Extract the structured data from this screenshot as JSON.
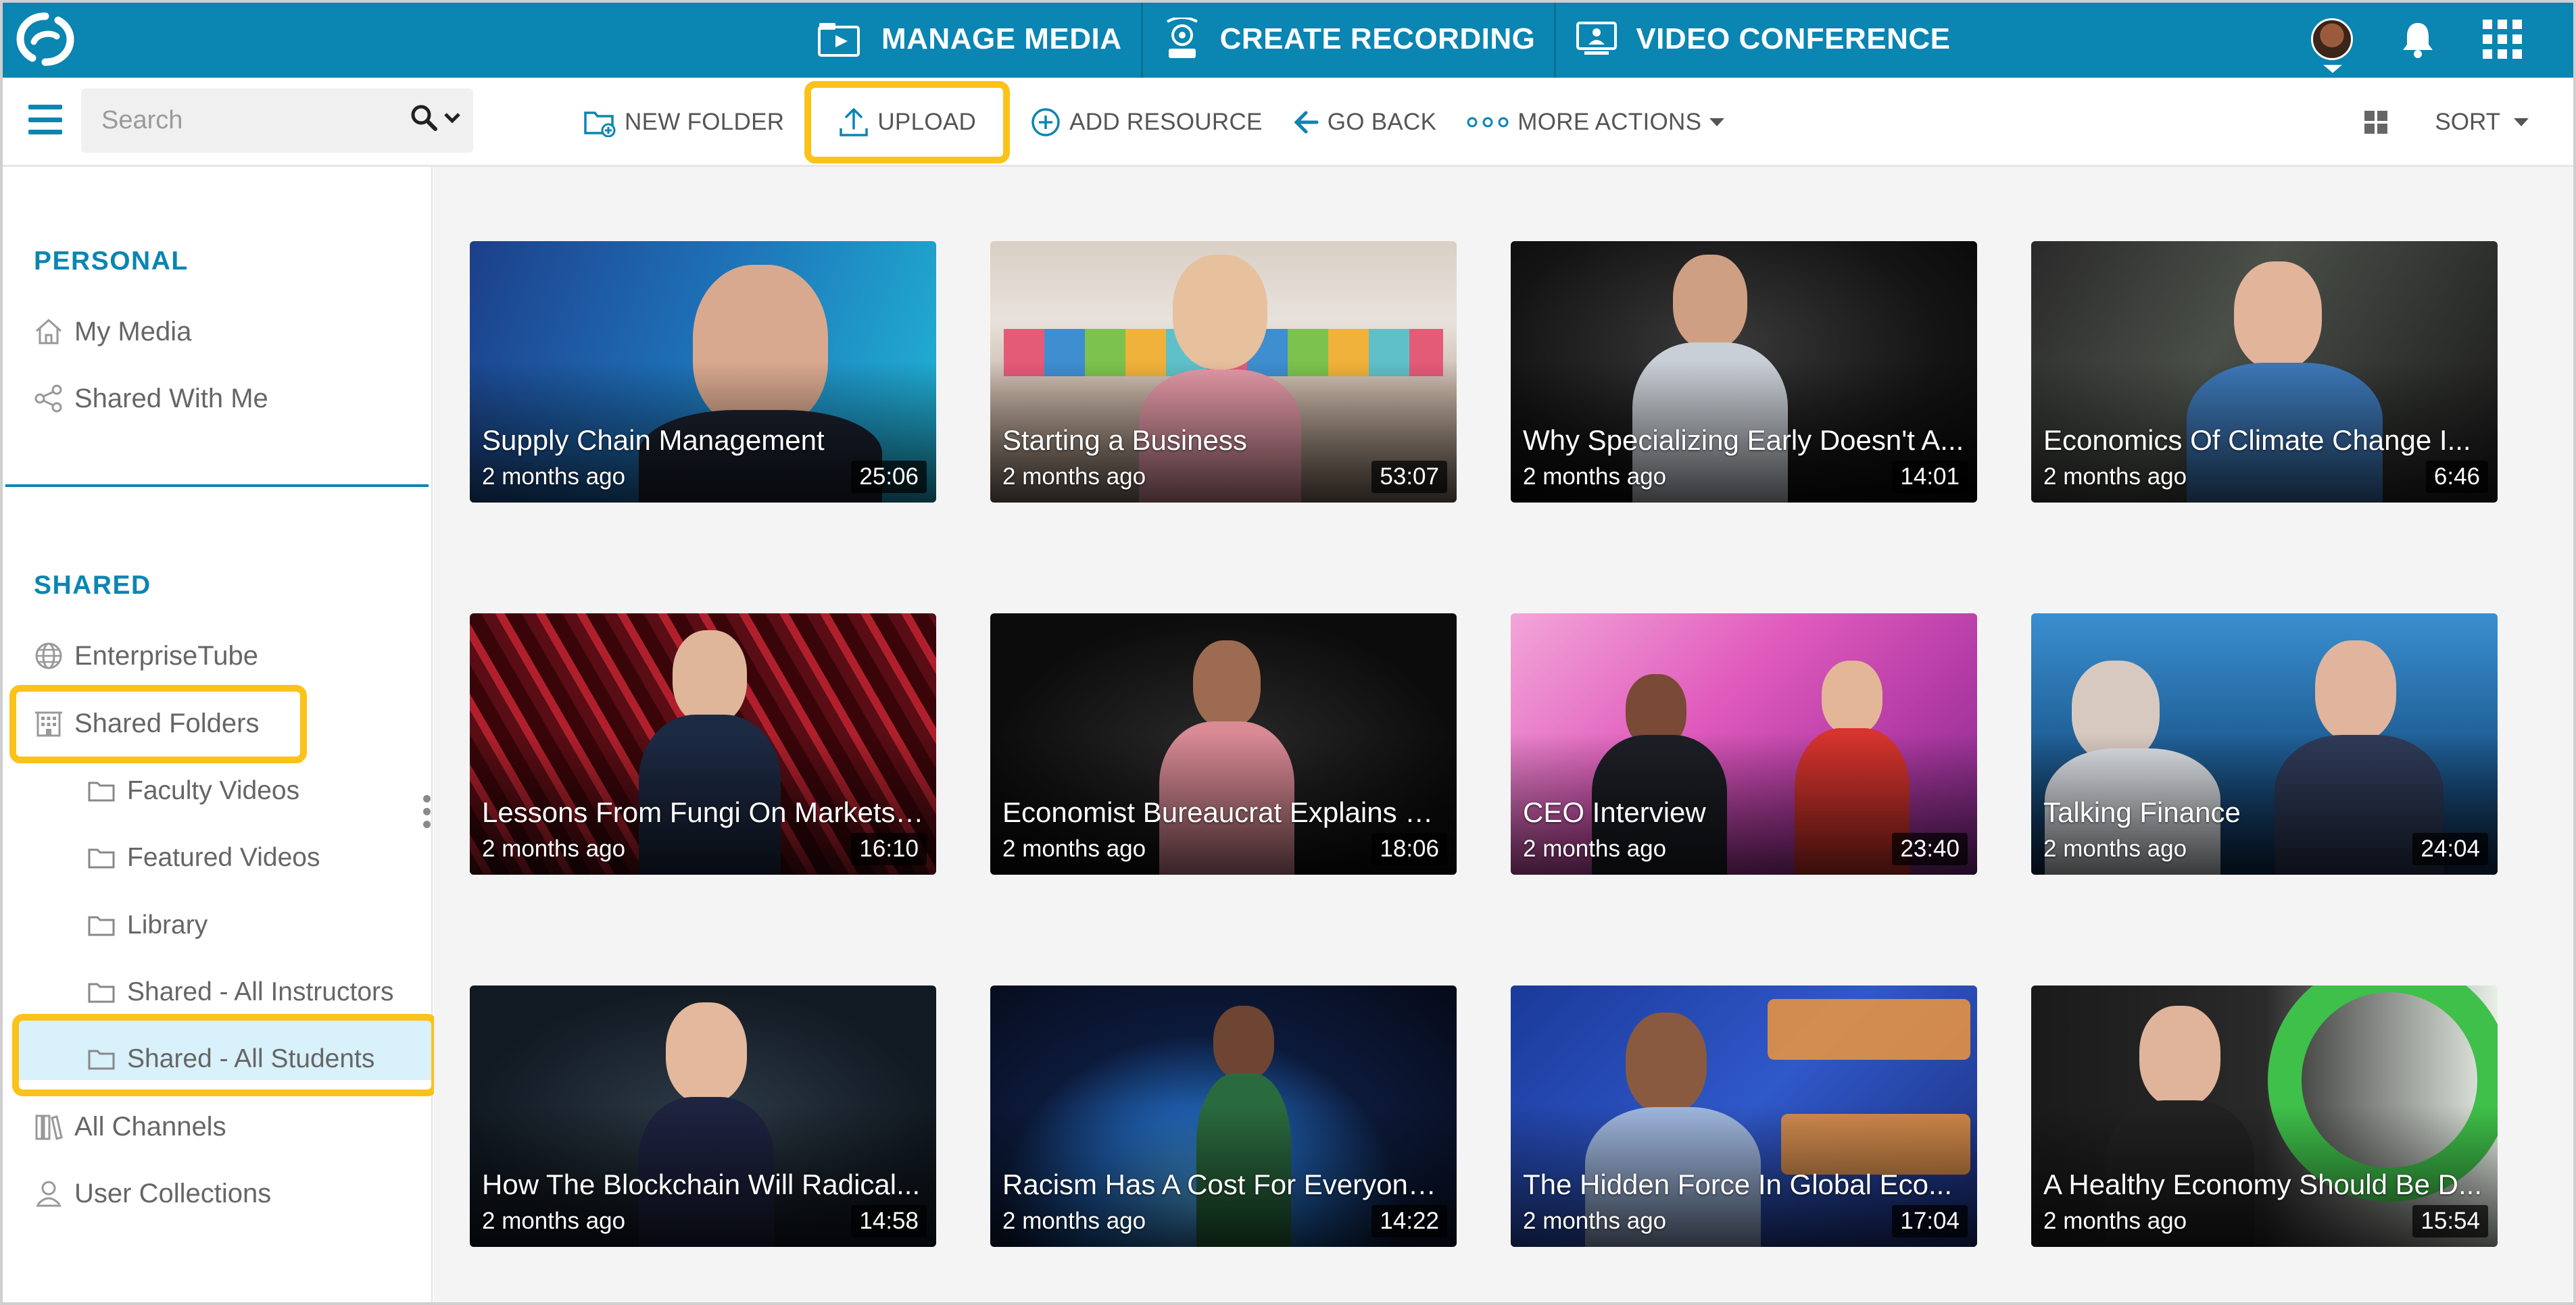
{
  "topnav": {
    "items": [
      {
        "label": "MANAGE MEDIA",
        "icon": "film-folder-icon"
      },
      {
        "label": "CREATE RECORDING",
        "icon": "webcam-icon"
      },
      {
        "label": "VIDEO CONFERENCE",
        "icon": "presenter-screen-icon"
      }
    ],
    "right_icons": [
      "avatar",
      "bell-icon",
      "apps-grid-icon"
    ]
  },
  "toolbar": {
    "search_placeholder": "Search",
    "actions": [
      {
        "label": "NEW FOLDER",
        "icon": "new-folder-icon"
      },
      {
        "label": "UPLOAD",
        "icon": "upload-icon",
        "highlighted": true
      },
      {
        "label": "ADD RESOURCE",
        "icon": "plus-circle-icon"
      },
      {
        "label": "GO BACK",
        "icon": "arrow-left-icon"
      },
      {
        "label": "MORE ACTIONS",
        "icon": "dots-icon"
      }
    ],
    "sort_label": "SORT",
    "view_icon": "grid-view-icon"
  },
  "sidebar": {
    "personal_title": "PERSONAL",
    "personal_items": [
      {
        "label": "My Media",
        "icon": "home-icon"
      },
      {
        "label": "Shared With Me",
        "icon": "share-icon"
      }
    ],
    "shared_title": "SHARED",
    "shared_items": [
      {
        "label": "EnterpriseTube",
        "icon": "globe-icon"
      },
      {
        "label": "Shared Folders",
        "icon": "building-icon",
        "highlighted": true
      }
    ],
    "folders": [
      {
        "label": "Faculty Videos"
      },
      {
        "label": "Featured Videos"
      },
      {
        "label": "Library"
      },
      {
        "label": "Shared - All Instructors"
      },
      {
        "label": "Shared - All Students",
        "selected": true
      }
    ],
    "bottom_items": [
      {
        "label": "All Channels",
        "icon": "books-icon"
      },
      {
        "label": "User Collections",
        "icon": "user-collection-icon"
      }
    ]
  },
  "videos": [
    {
      "title": "Supply Chain Management",
      "date": "2 months ago",
      "duration": "25:06"
    },
    {
      "title": "Starting a Business",
      "date": "2 months ago",
      "duration": "53:07"
    },
    {
      "title": "Why Specializing Early Doesn't A...",
      "date": "2 months ago",
      "duration": "14:01"
    },
    {
      "title": "Economics Of Climate Change I...",
      "date": "2 months ago",
      "duration": "6:46"
    },
    {
      "title": "Lessons From Fungi On Markets ...",
      "date": "2 months ago",
      "duration": "16:10"
    },
    {
      "title": "Economist Bureaucrat Explains H...",
      "date": "2 months ago",
      "duration": "18:06"
    },
    {
      "title": "CEO Interview",
      "date": "2 months ago",
      "duration": "23:40"
    },
    {
      "title": "Talking Finance",
      "date": "2 months ago",
      "duration": "24:04"
    },
    {
      "title": "How The Blockchain Will Radical...",
      "date": "2 months ago",
      "duration": "14:58"
    },
    {
      "title": "Racism Has A Cost For Everyone...",
      "date": "2 months ago",
      "duration": "14:22"
    },
    {
      "title": "The Hidden Force In Global Eco...",
      "date": "2 months ago",
      "duration": "17:04"
    },
    {
      "title": "A Healthy Economy Should Be D...",
      "date": "2 months ago",
      "duration": "15:54"
    }
  ],
  "colors": {
    "brand": "#0b85b1",
    "highlight": "#fbc21a",
    "selected_bg": "#d8f1fb"
  }
}
